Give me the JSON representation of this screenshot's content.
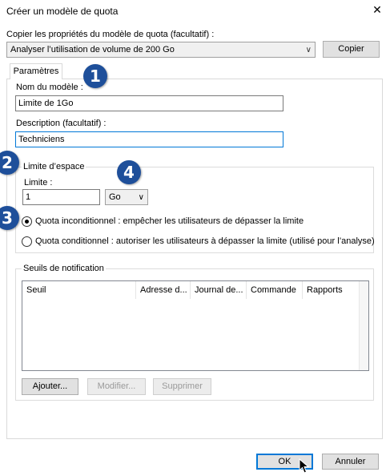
{
  "window": {
    "title": "Créer un modèle de quota",
    "close_glyph": "✕"
  },
  "copy_section": {
    "label": "Copier les propriétés du modèle de quota (facultatif) :",
    "selected_template": "Analyser l’utilisation de volume de 200 Go",
    "copy_button": "Copier"
  },
  "tabs": [
    {
      "label": "Paramètres"
    }
  ],
  "template_name": {
    "label": "Nom du modèle :",
    "value": "Limite de 1Go"
  },
  "description": {
    "label": "Description (facultatif) :",
    "value": "Techniciens"
  },
  "space_limit": {
    "group_title": "Limite d’espace",
    "limit_label": "Limite :",
    "limit_value": "1",
    "unit": "Go",
    "hard_quota_label": "Quota inconditionnel : empêcher les utilisateurs de dépasser la limite",
    "soft_quota_label": "Quota conditionnel : autoriser les utilisateurs à dépasser la limite (utilisé pour l’analyse)",
    "selected": "hard"
  },
  "notifications": {
    "group_title": "Seuils de notification",
    "columns": [
      "Seuil",
      "Adresse d...",
      "Journal de...",
      "Commande",
      "Rapports"
    ],
    "rows": [],
    "add_button": "Ajouter...",
    "edit_button": "Modifier...",
    "delete_button": "Supprimer"
  },
  "footer": {
    "ok_button": "OK",
    "cancel_button": "Annuler"
  },
  "callouts": [
    "1",
    "2",
    "3",
    "4"
  ],
  "colors": {
    "callout_badge": "#1e4f9a",
    "focus_border": "#0078d7"
  }
}
